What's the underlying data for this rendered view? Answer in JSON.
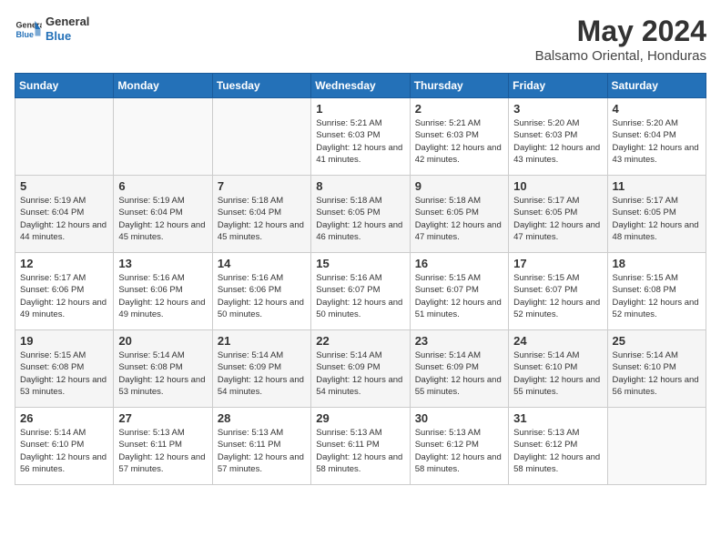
{
  "header": {
    "logo_general": "General",
    "logo_blue": "Blue",
    "month_year": "May 2024",
    "location": "Balsamo Oriental, Honduras"
  },
  "days_of_week": [
    "Sunday",
    "Monday",
    "Tuesday",
    "Wednesday",
    "Thursday",
    "Friday",
    "Saturday"
  ],
  "weeks": [
    [
      {
        "day": "",
        "sunrise": "",
        "sunset": "",
        "daylight": ""
      },
      {
        "day": "",
        "sunrise": "",
        "sunset": "",
        "daylight": ""
      },
      {
        "day": "",
        "sunrise": "",
        "sunset": "",
        "daylight": ""
      },
      {
        "day": "1",
        "sunrise": "Sunrise: 5:21 AM",
        "sunset": "Sunset: 6:03 PM",
        "daylight": "Daylight: 12 hours and 41 minutes."
      },
      {
        "day": "2",
        "sunrise": "Sunrise: 5:21 AM",
        "sunset": "Sunset: 6:03 PM",
        "daylight": "Daylight: 12 hours and 42 minutes."
      },
      {
        "day": "3",
        "sunrise": "Sunrise: 5:20 AM",
        "sunset": "Sunset: 6:03 PM",
        "daylight": "Daylight: 12 hours and 43 minutes."
      },
      {
        "day": "4",
        "sunrise": "Sunrise: 5:20 AM",
        "sunset": "Sunset: 6:04 PM",
        "daylight": "Daylight: 12 hours and 43 minutes."
      }
    ],
    [
      {
        "day": "5",
        "sunrise": "Sunrise: 5:19 AM",
        "sunset": "Sunset: 6:04 PM",
        "daylight": "Daylight: 12 hours and 44 minutes."
      },
      {
        "day": "6",
        "sunrise": "Sunrise: 5:19 AM",
        "sunset": "Sunset: 6:04 PM",
        "daylight": "Daylight: 12 hours and 45 minutes."
      },
      {
        "day": "7",
        "sunrise": "Sunrise: 5:18 AM",
        "sunset": "Sunset: 6:04 PM",
        "daylight": "Daylight: 12 hours and 45 minutes."
      },
      {
        "day": "8",
        "sunrise": "Sunrise: 5:18 AM",
        "sunset": "Sunset: 6:05 PM",
        "daylight": "Daylight: 12 hours and 46 minutes."
      },
      {
        "day": "9",
        "sunrise": "Sunrise: 5:18 AM",
        "sunset": "Sunset: 6:05 PM",
        "daylight": "Daylight: 12 hours and 47 minutes."
      },
      {
        "day": "10",
        "sunrise": "Sunrise: 5:17 AM",
        "sunset": "Sunset: 6:05 PM",
        "daylight": "Daylight: 12 hours and 47 minutes."
      },
      {
        "day": "11",
        "sunrise": "Sunrise: 5:17 AM",
        "sunset": "Sunset: 6:05 PM",
        "daylight": "Daylight: 12 hours and 48 minutes."
      }
    ],
    [
      {
        "day": "12",
        "sunrise": "Sunrise: 5:17 AM",
        "sunset": "Sunset: 6:06 PM",
        "daylight": "Daylight: 12 hours and 49 minutes."
      },
      {
        "day": "13",
        "sunrise": "Sunrise: 5:16 AM",
        "sunset": "Sunset: 6:06 PM",
        "daylight": "Daylight: 12 hours and 49 minutes."
      },
      {
        "day": "14",
        "sunrise": "Sunrise: 5:16 AM",
        "sunset": "Sunset: 6:06 PM",
        "daylight": "Daylight: 12 hours and 50 minutes."
      },
      {
        "day": "15",
        "sunrise": "Sunrise: 5:16 AM",
        "sunset": "Sunset: 6:07 PM",
        "daylight": "Daylight: 12 hours and 50 minutes."
      },
      {
        "day": "16",
        "sunrise": "Sunrise: 5:15 AM",
        "sunset": "Sunset: 6:07 PM",
        "daylight": "Daylight: 12 hours and 51 minutes."
      },
      {
        "day": "17",
        "sunrise": "Sunrise: 5:15 AM",
        "sunset": "Sunset: 6:07 PM",
        "daylight": "Daylight: 12 hours and 52 minutes."
      },
      {
        "day": "18",
        "sunrise": "Sunrise: 5:15 AM",
        "sunset": "Sunset: 6:08 PM",
        "daylight": "Daylight: 12 hours and 52 minutes."
      }
    ],
    [
      {
        "day": "19",
        "sunrise": "Sunrise: 5:15 AM",
        "sunset": "Sunset: 6:08 PM",
        "daylight": "Daylight: 12 hours and 53 minutes."
      },
      {
        "day": "20",
        "sunrise": "Sunrise: 5:14 AM",
        "sunset": "Sunset: 6:08 PM",
        "daylight": "Daylight: 12 hours and 53 minutes."
      },
      {
        "day": "21",
        "sunrise": "Sunrise: 5:14 AM",
        "sunset": "Sunset: 6:09 PM",
        "daylight": "Daylight: 12 hours and 54 minutes."
      },
      {
        "day": "22",
        "sunrise": "Sunrise: 5:14 AM",
        "sunset": "Sunset: 6:09 PM",
        "daylight": "Daylight: 12 hours and 54 minutes."
      },
      {
        "day": "23",
        "sunrise": "Sunrise: 5:14 AM",
        "sunset": "Sunset: 6:09 PM",
        "daylight": "Daylight: 12 hours and 55 minutes."
      },
      {
        "day": "24",
        "sunrise": "Sunrise: 5:14 AM",
        "sunset": "Sunset: 6:10 PM",
        "daylight": "Daylight: 12 hours and 55 minutes."
      },
      {
        "day": "25",
        "sunrise": "Sunrise: 5:14 AM",
        "sunset": "Sunset: 6:10 PM",
        "daylight": "Daylight: 12 hours and 56 minutes."
      }
    ],
    [
      {
        "day": "26",
        "sunrise": "Sunrise: 5:14 AM",
        "sunset": "Sunset: 6:10 PM",
        "daylight": "Daylight: 12 hours and 56 minutes."
      },
      {
        "day": "27",
        "sunrise": "Sunrise: 5:13 AM",
        "sunset": "Sunset: 6:11 PM",
        "daylight": "Daylight: 12 hours and 57 minutes."
      },
      {
        "day": "28",
        "sunrise": "Sunrise: 5:13 AM",
        "sunset": "Sunset: 6:11 PM",
        "daylight": "Daylight: 12 hours and 57 minutes."
      },
      {
        "day": "29",
        "sunrise": "Sunrise: 5:13 AM",
        "sunset": "Sunset: 6:11 PM",
        "daylight": "Daylight: 12 hours and 58 minutes."
      },
      {
        "day": "30",
        "sunrise": "Sunrise: 5:13 AM",
        "sunset": "Sunset: 6:12 PM",
        "daylight": "Daylight: 12 hours and 58 minutes."
      },
      {
        "day": "31",
        "sunrise": "Sunrise: 5:13 AM",
        "sunset": "Sunset: 6:12 PM",
        "daylight": "Daylight: 12 hours and 58 minutes."
      },
      {
        "day": "",
        "sunrise": "",
        "sunset": "",
        "daylight": ""
      }
    ]
  ]
}
